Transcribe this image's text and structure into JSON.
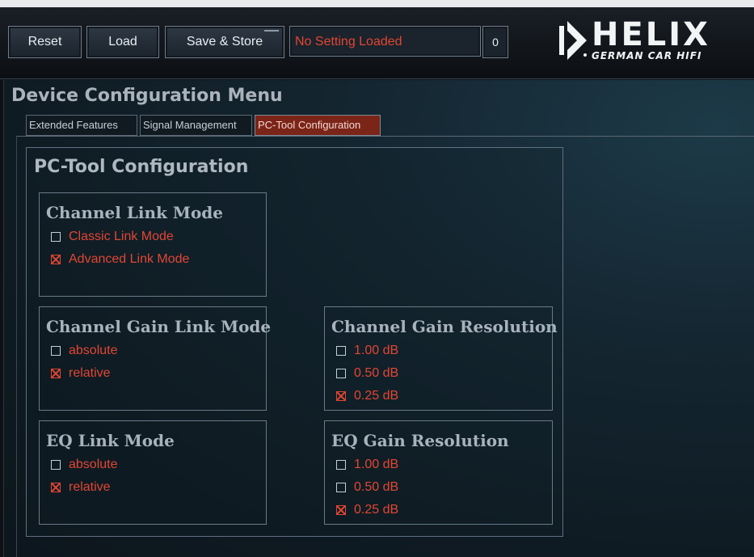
{
  "toolbar": {
    "reset_label": "Reset",
    "load_label": "Load",
    "save_label": "Save & Store",
    "status_text": "No Setting Loaded",
    "counter_value": "0"
  },
  "brand": {
    "name": "HELIX",
    "tagline": "GERMAN CAR HIFI"
  },
  "menu": {
    "title": "Device Configuration Menu",
    "tabs": [
      {
        "label": "Extended Features"
      },
      {
        "label": "Signal Management"
      },
      {
        "label": "PC-Tool Configuration",
        "active": true
      }
    ]
  },
  "config": {
    "title": "PC-Tool Configuration",
    "groups": [
      {
        "title": "Channel Link Mode",
        "options": [
          {
            "label": "Classic Link Mode",
            "checked": false
          },
          {
            "label": "Advanced Link Mode",
            "checked": true
          }
        ]
      },
      {
        "title": "Channel Gain Link Mode",
        "options": [
          {
            "label": "absolute",
            "checked": false
          },
          {
            "label": "relative",
            "checked": true
          }
        ]
      },
      {
        "title": "Channel Gain Resolution",
        "options": [
          {
            "label": "1.00 dB",
            "checked": false
          },
          {
            "label": "0.50 dB",
            "checked": false
          },
          {
            "label": "0.25 dB",
            "checked": true
          }
        ]
      },
      {
        "title": "EQ Link Mode",
        "options": [
          {
            "label": "absolute",
            "checked": false
          },
          {
            "label": "relative",
            "checked": true
          }
        ]
      },
      {
        "title": "EQ Gain Resolution",
        "options": [
          {
            "label": "1.00 dB",
            "checked": false
          },
          {
            "label": "0.50 dB",
            "checked": false
          },
          {
            "label": "0.25 dB",
            "checked": true
          }
        ]
      }
    ]
  },
  "colors": {
    "accent_red": "#e24633",
    "active_tab": "#7b2418",
    "text_gray": "#a8b3bd"
  }
}
